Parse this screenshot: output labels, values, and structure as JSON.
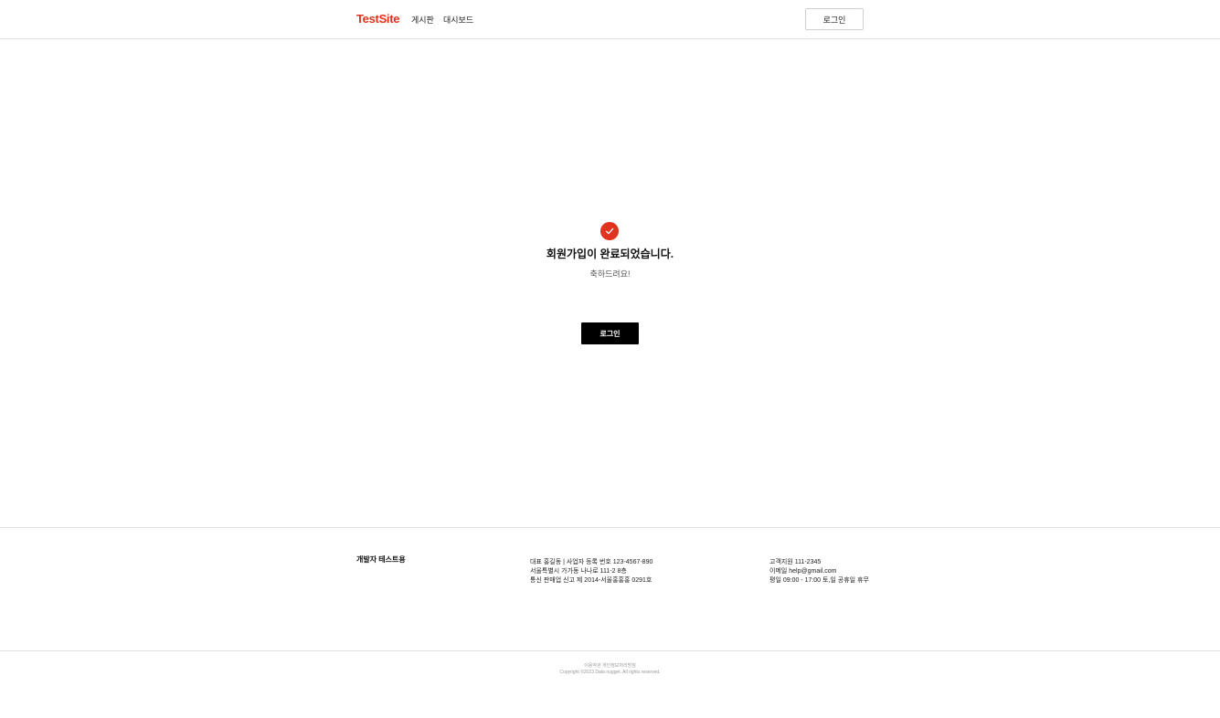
{
  "header": {
    "logo": "TestSite",
    "nav": [
      "게시판",
      "대시보드"
    ],
    "login_label": "로그인"
  },
  "main": {
    "title": "회원가입이 완료되었습니다.",
    "subtitle": "축하드려요!",
    "login_label": "로그인",
    "icon": "check-circle-icon",
    "accent_color": "#e0321e"
  },
  "footer": {
    "brand": "개발자 테스트용",
    "company_info": [
      "대표 홍길동  |  사업자 등록 번호 123-4567-890",
      "서울특별시 가가동 나나로 111-2 8층",
      "통신 판매업 신고 제 2014-서울홍홍홍 0291호"
    ],
    "support_info": [
      "고객지원 111-2345",
      "이메일 help@gmail.com",
      "평일 09:00 - 17:00 토,일 공휴일 휴무"
    ],
    "bottom_links": "이용약관  개인정보처리방침",
    "copyright": "Copyright ©2023 Data nugget. All rights reserved."
  }
}
